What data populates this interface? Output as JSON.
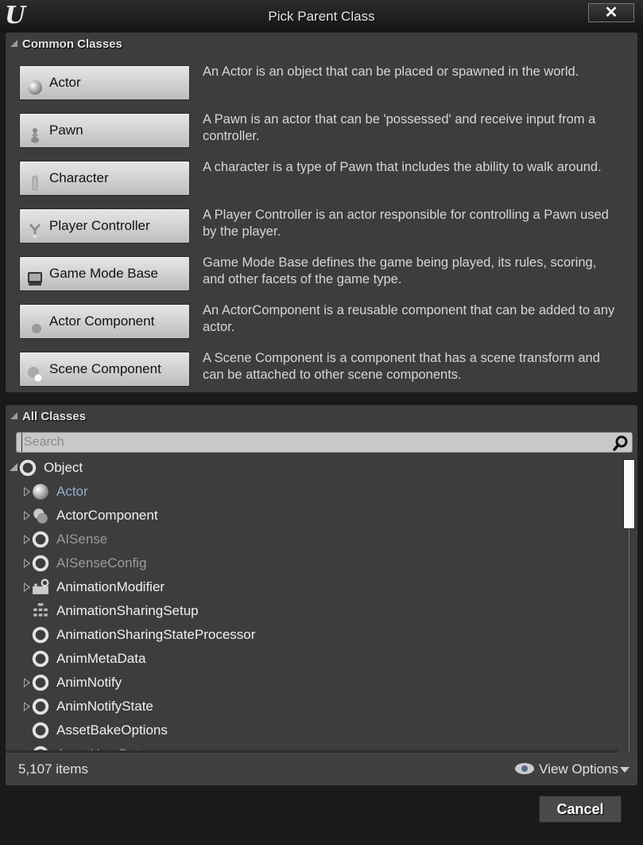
{
  "window": {
    "title": "Pick Parent Class",
    "logo": "U",
    "close_label": "✕"
  },
  "common_classes": {
    "header": "Common Classes",
    "items": [
      {
        "label": "Actor",
        "icon": "actor-sphere-icon",
        "description": "An Actor is an object that can be placed or spawned in the world."
      },
      {
        "label": "Pawn",
        "icon": "pawn-icon",
        "description": "A Pawn is an actor that can be 'possessed' and receive input from a controller."
      },
      {
        "label": "Character",
        "icon": "character-icon",
        "description": "A character is a type of Pawn that includes the ability to walk around."
      },
      {
        "label": "Player Controller",
        "icon": "player-controller-icon",
        "description": "A Player Controller is an actor responsible for controlling a Pawn used by the player."
      },
      {
        "label": "Game Mode Base",
        "icon": "game-mode-icon",
        "description": "Game Mode Base defines the game being played, its rules, scoring, and other facets of the game type."
      },
      {
        "label": "Actor Component",
        "icon": "actor-component-icon",
        "description": "An ActorComponent is a reusable component that can be added to any actor."
      },
      {
        "label": "Scene Component",
        "icon": "scene-component-icon",
        "description": "A Scene Component is a component that has a scene transform and can be attached to other scene components."
      }
    ]
  },
  "all_classes": {
    "header": "All Classes",
    "search": {
      "placeholder": "Search",
      "value": ""
    },
    "tree": [
      {
        "label": "Object",
        "icon": "object-ring-icon",
        "depth": 0,
        "expander": "open",
        "color": "#f0f0f0"
      },
      {
        "label": "Actor",
        "icon": "actor-sphere-icon",
        "depth": 1,
        "expander": "closed",
        "color": "#8fb0d0"
      },
      {
        "label": "ActorComponent",
        "icon": "actor-component-icon",
        "depth": 1,
        "expander": "closed",
        "color": "#f0f0f0"
      },
      {
        "label": "AISense",
        "icon": "object-ring-icon",
        "depth": 1,
        "expander": "closed",
        "color": "#9a9a9a"
      },
      {
        "label": "AISenseConfig",
        "icon": "object-ring-icon",
        "depth": 1,
        "expander": "closed",
        "color": "#9a9a9a"
      },
      {
        "label": "AnimationModifier",
        "icon": "animation-modifier-icon",
        "depth": 1,
        "expander": "closed",
        "color": "#f0f0f0"
      },
      {
        "label": "AnimationSharingSetup",
        "icon": "animation-sharing-setup-icon",
        "depth": 1,
        "expander": "none",
        "color": "#f0f0f0"
      },
      {
        "label": "AnimationSharingStateProcessor",
        "icon": "object-ring-icon",
        "depth": 1,
        "expander": "none",
        "color": "#f0f0f0"
      },
      {
        "label": "AnimMetaData",
        "icon": "object-ring-icon",
        "depth": 1,
        "expander": "none",
        "color": "#f0f0f0"
      },
      {
        "label": "AnimNotify",
        "icon": "object-ring-icon",
        "depth": 1,
        "expander": "closed",
        "color": "#f0f0f0"
      },
      {
        "label": "AnimNotifyState",
        "icon": "object-ring-icon",
        "depth": 1,
        "expander": "closed",
        "color": "#f0f0f0"
      },
      {
        "label": "AssetBakeOptions",
        "icon": "object-ring-icon",
        "depth": 1,
        "expander": "none",
        "color": "#f0f0f0"
      },
      {
        "label": "AssetUserData",
        "icon": "object-ring-icon",
        "depth": 1,
        "expander": "closed",
        "color": "#9a9a9a"
      }
    ],
    "item_count": "5,107 items",
    "view_options_label": "View Options"
  },
  "footer": {
    "cancel_label": "Cancel"
  }
}
